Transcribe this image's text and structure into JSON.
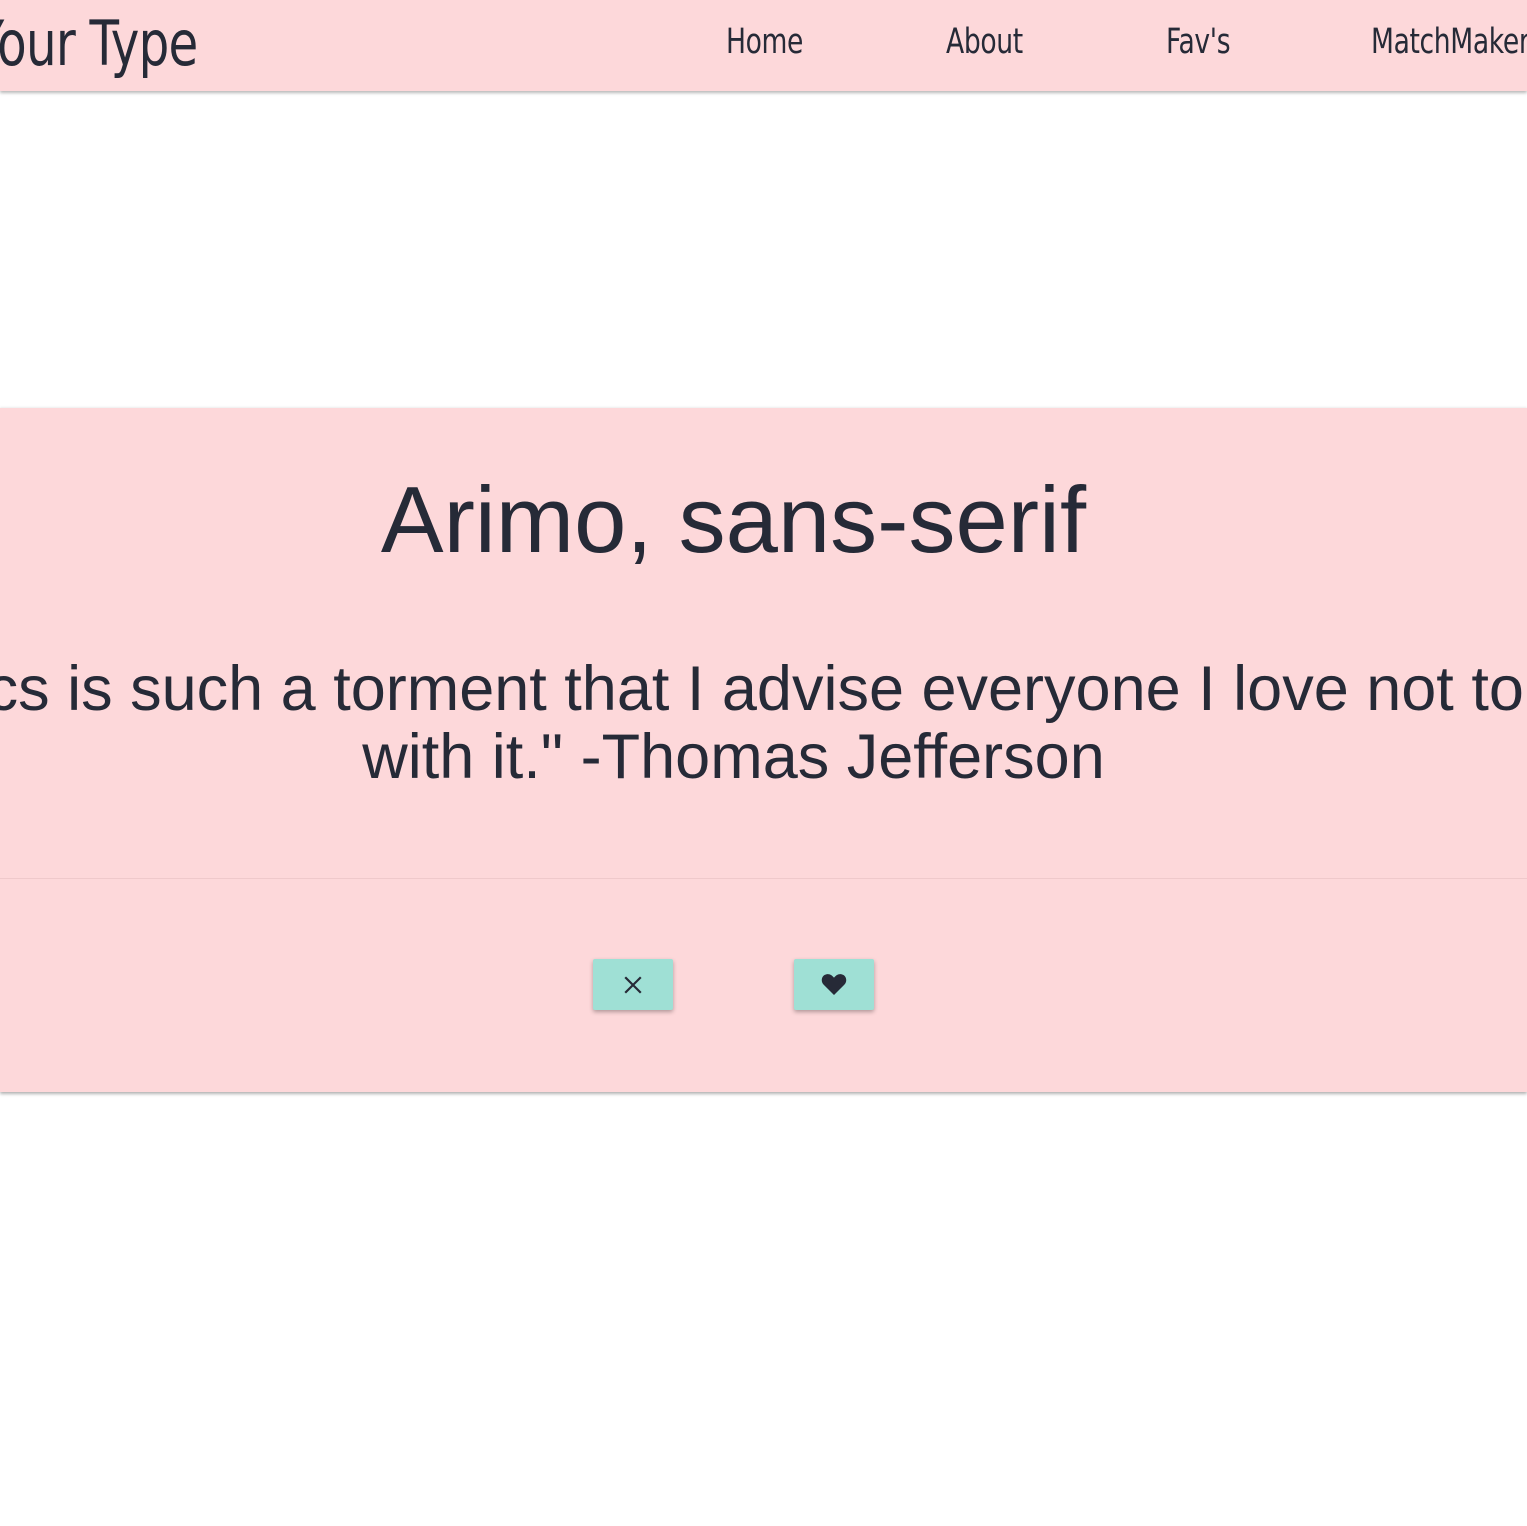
{
  "header": {
    "brand": "Your Type",
    "nav": [
      {
        "label": "Home"
      },
      {
        "label": "About"
      },
      {
        "label": "Fav's"
      },
      {
        "label": "MatchMaker"
      }
    ]
  },
  "card": {
    "font_name": "Arimo, sans-serif",
    "quote_line1": "\"Politics is such a torment that I advise everyone I love not to mix",
    "quote_line2": "with it.\" -Thomas Jefferson"
  },
  "actions": {
    "reject_icon": "close-icon",
    "like_icon": "heart-icon"
  },
  "colors": {
    "background": "#ffffff",
    "pink": "#fdd8da",
    "button": "#9fe0d5",
    "text": "#262a37"
  }
}
